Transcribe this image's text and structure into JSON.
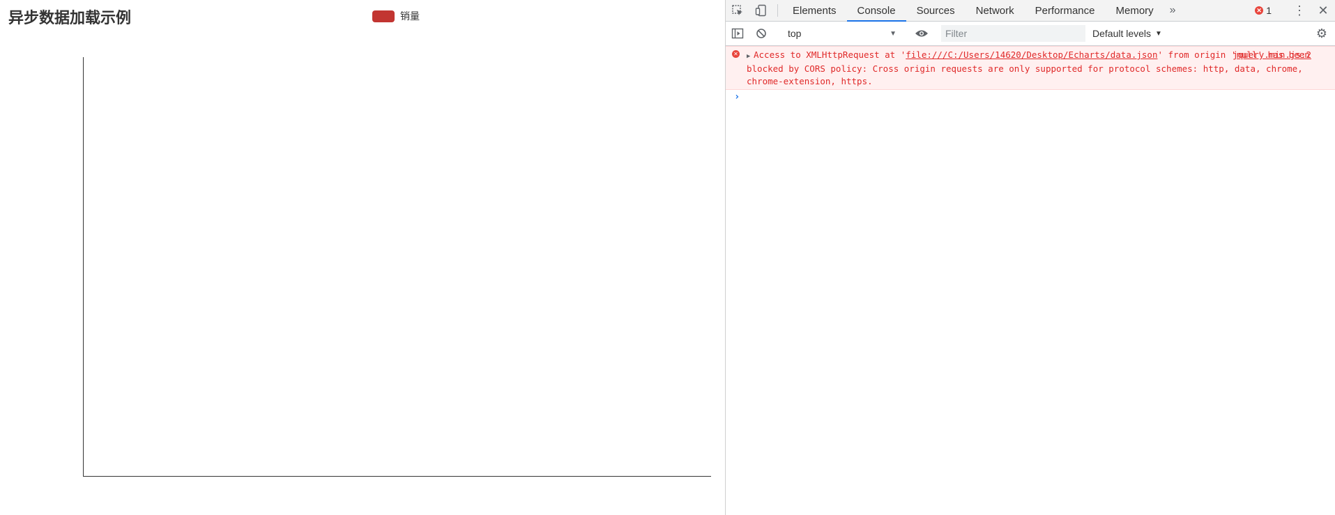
{
  "chart": {
    "title": "异步数据加载示例",
    "legend": {
      "label": "销量",
      "color": "#c23531"
    }
  },
  "chart_data": {
    "type": "bar",
    "title": "异步数据加载示例",
    "series": [
      {
        "name": "销量",
        "values": []
      }
    ],
    "categories": [],
    "legend": "top-center",
    "grid": false
  },
  "devtools": {
    "tabs": [
      {
        "label": "Elements",
        "active": false
      },
      {
        "label": "Console",
        "active": true
      },
      {
        "label": "Sources",
        "active": false
      },
      {
        "label": "Network",
        "active": false
      },
      {
        "label": "Performance",
        "active": false
      },
      {
        "label": "Memory",
        "active": false
      }
    ],
    "more_label": "»",
    "error_count": "1",
    "context": "top",
    "filter_placeholder": "Filter",
    "levels_label": "Default levels",
    "error_color": "#e02828",
    "accent": "#1a73e8"
  },
  "console": {
    "error": {
      "text_before": "Access to XMLHttpRequest at '",
      "url": "file:///C:/Users/14620/Desktop/Echarts/data.json",
      "text_after": "' from origin 'null' has been blocked by CORS policy: Cross origin requests are only supported for protocol schemes: http, data, chrome, chrome-extension, https.",
      "source": "jquery.min.js:2"
    },
    "prompt": "›"
  }
}
